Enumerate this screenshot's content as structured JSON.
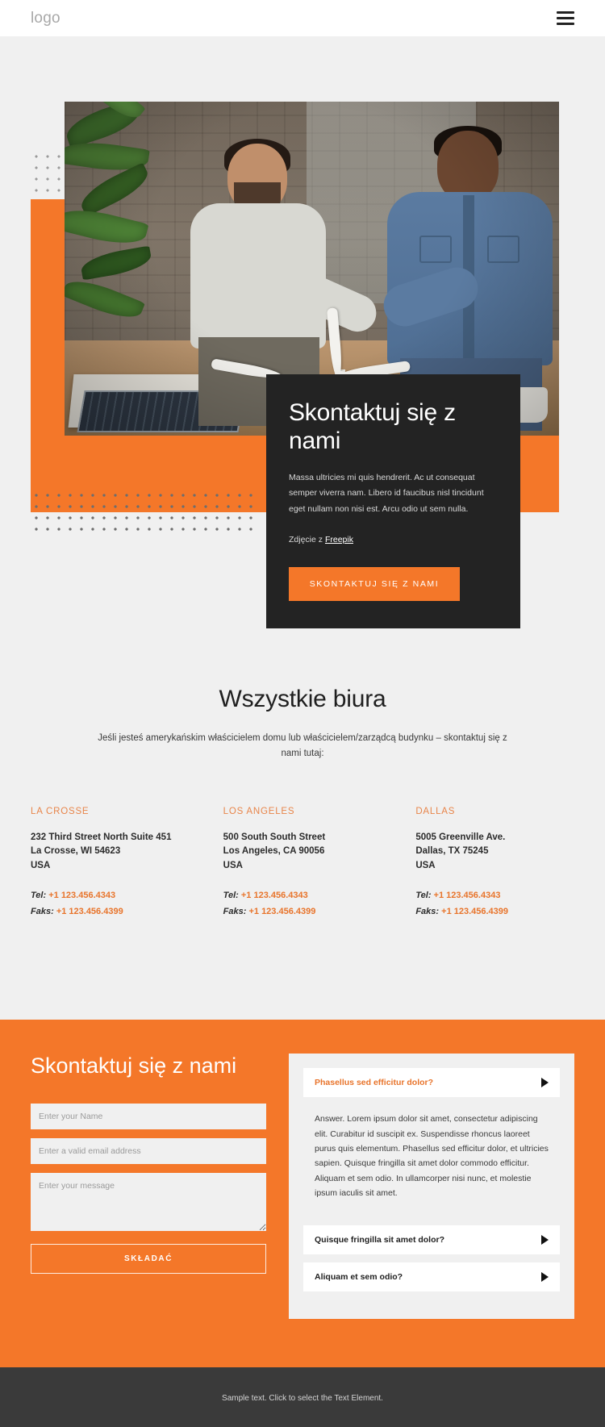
{
  "header": {
    "logo": "logo",
    "menu_icon": "hamburger-icon"
  },
  "hero": {
    "title": "Skontaktuj się z nami",
    "paragraph": "Massa ultricies mi quis hendrerit. Ac ut consequat semper viverra nam. Libero id faucibus nisl tincidunt eget nullam non nisi est. Arcu odio ut sem nulla.",
    "credit_prefix": "Zdjęcie z ",
    "credit_link": "Freepik",
    "cta_label": "SKONTAKTUJ SIĘ Z NAMI"
  },
  "offices": {
    "title": "Wszystkie biura",
    "subtitle": "Jeśli jesteś amerykańskim właścicielem domu lub właścicielem/zarządcą budynku – skontaktuj się z nami tutaj:",
    "tel_label": "Tel:",
    "fax_label": "Faks:",
    "items": [
      {
        "city": "LA CROSSE",
        "address_line1": "232 Third Street North Suite 451",
        "address_line2": "La Crosse, WI 54623",
        "address_line3": "USA",
        "tel": "+1 123.456.4343",
        "fax": "+1 123.456.4399"
      },
      {
        "city": "LOS ANGELES",
        "address_line1": "500 South South Street",
        "address_line2": "Los Angeles, CA 90056",
        "address_line3": "USA",
        "tel": "+1 123.456.4343",
        "fax": "+1 123.456.4399"
      },
      {
        "city": "DALLAS",
        "address_line1": "5005 Greenville Ave.",
        "address_line2": "Dallas, TX 75245",
        "address_line3": "USA",
        "tel": "+1 123.456.4343",
        "fax": "+1 123.456.4399"
      }
    ]
  },
  "contact": {
    "title": "Skontaktuj się z nami",
    "name_placeholder": "Enter your Name",
    "email_placeholder": "Enter a valid email address",
    "message_placeholder": "Enter your message",
    "submit_label": "SKŁADAĆ"
  },
  "faq": {
    "items": [
      {
        "question": "Phasellus sed efficitur dolor?",
        "answer": "Answer. Lorem ipsum dolor sit amet, consectetur adipiscing elit. Curabitur id suscipit ex. Suspendisse rhoncus laoreet purus quis elementum. Phasellus sed efficitur dolor, et ultricies sapien. Quisque fringilla sit amet dolor commodo efficitur. Aliquam et sem odio. In ullamcorper nisi nunc, et molestie ipsum iaculis sit amet.",
        "open": true
      },
      {
        "question": "Quisque fringilla sit amet dolor?",
        "answer": "",
        "open": false
      },
      {
        "question": "Aliquam et sem odio?",
        "answer": "",
        "open": false
      }
    ]
  },
  "footer": {
    "text": "Sample text. Click to select the Text Element."
  },
  "colors": {
    "accent": "#f47729",
    "accent_text": "#e8742b",
    "dark_card": "#232323",
    "page_bg": "#f0f0f0",
    "footer_bg": "#3a3a3a"
  }
}
